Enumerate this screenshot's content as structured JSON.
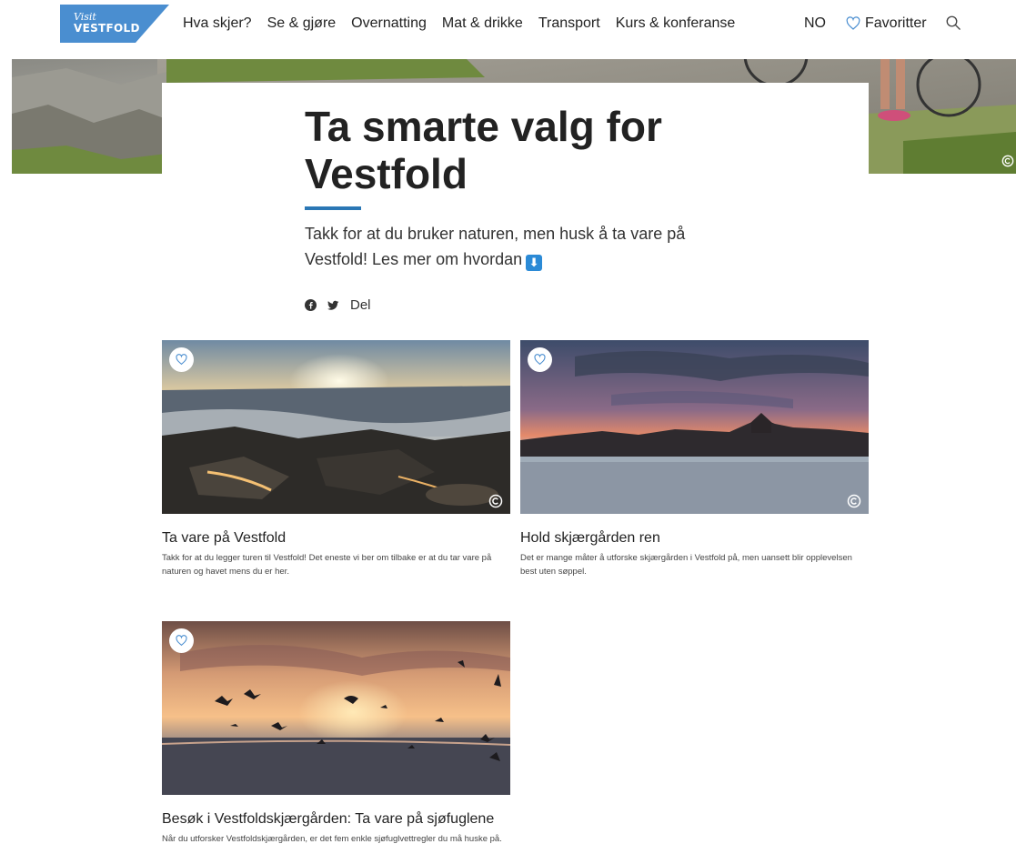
{
  "brand": {
    "logo_top": "Visit",
    "logo_bottom": "VESTFOLD",
    "color": "#4a8ed0"
  },
  "nav": {
    "items": [
      {
        "label": "Hva skjer?"
      },
      {
        "label": "Se & gjøre"
      },
      {
        "label": "Overnatting"
      },
      {
        "label": "Mat & drikke"
      },
      {
        "label": "Transport"
      },
      {
        "label": "Kurs & konferanse"
      }
    ],
    "language": "NO",
    "favorites_label": "Favoritter",
    "icons": {
      "favorites": "heart-outline-icon",
      "search": "magnifier-icon"
    }
  },
  "page": {
    "title": "Ta smarte valg for Vestfold",
    "lead": "Takk for at du bruker naturen, men husk å ta vare på Vestfold! Les mer om hvordan",
    "lead_icon": "⬇",
    "share_label": "Del",
    "accent": "#2a77b5"
  },
  "cards": [
    {
      "title": "Ta vare på Vestfold",
      "description": "Takk for at du legger turen til Vestfold! Det eneste vi ber om tilbake er at du tar vare på naturen og havet mens du er her."
    },
    {
      "title": "Hold skjærgården ren",
      "description": "Det er mange måter å utforske skjærgården i Vestfold på, men uansett blir opplevelsen best uten søppel."
    },
    {
      "title": "Besøk i Vestfoldskjærgården: Ta vare på sjøfuglene",
      "description": "Når du utforsker Vestfoldskjærgården, er det fem enkle sjøfuglvettregler du må huske på."
    }
  ]
}
